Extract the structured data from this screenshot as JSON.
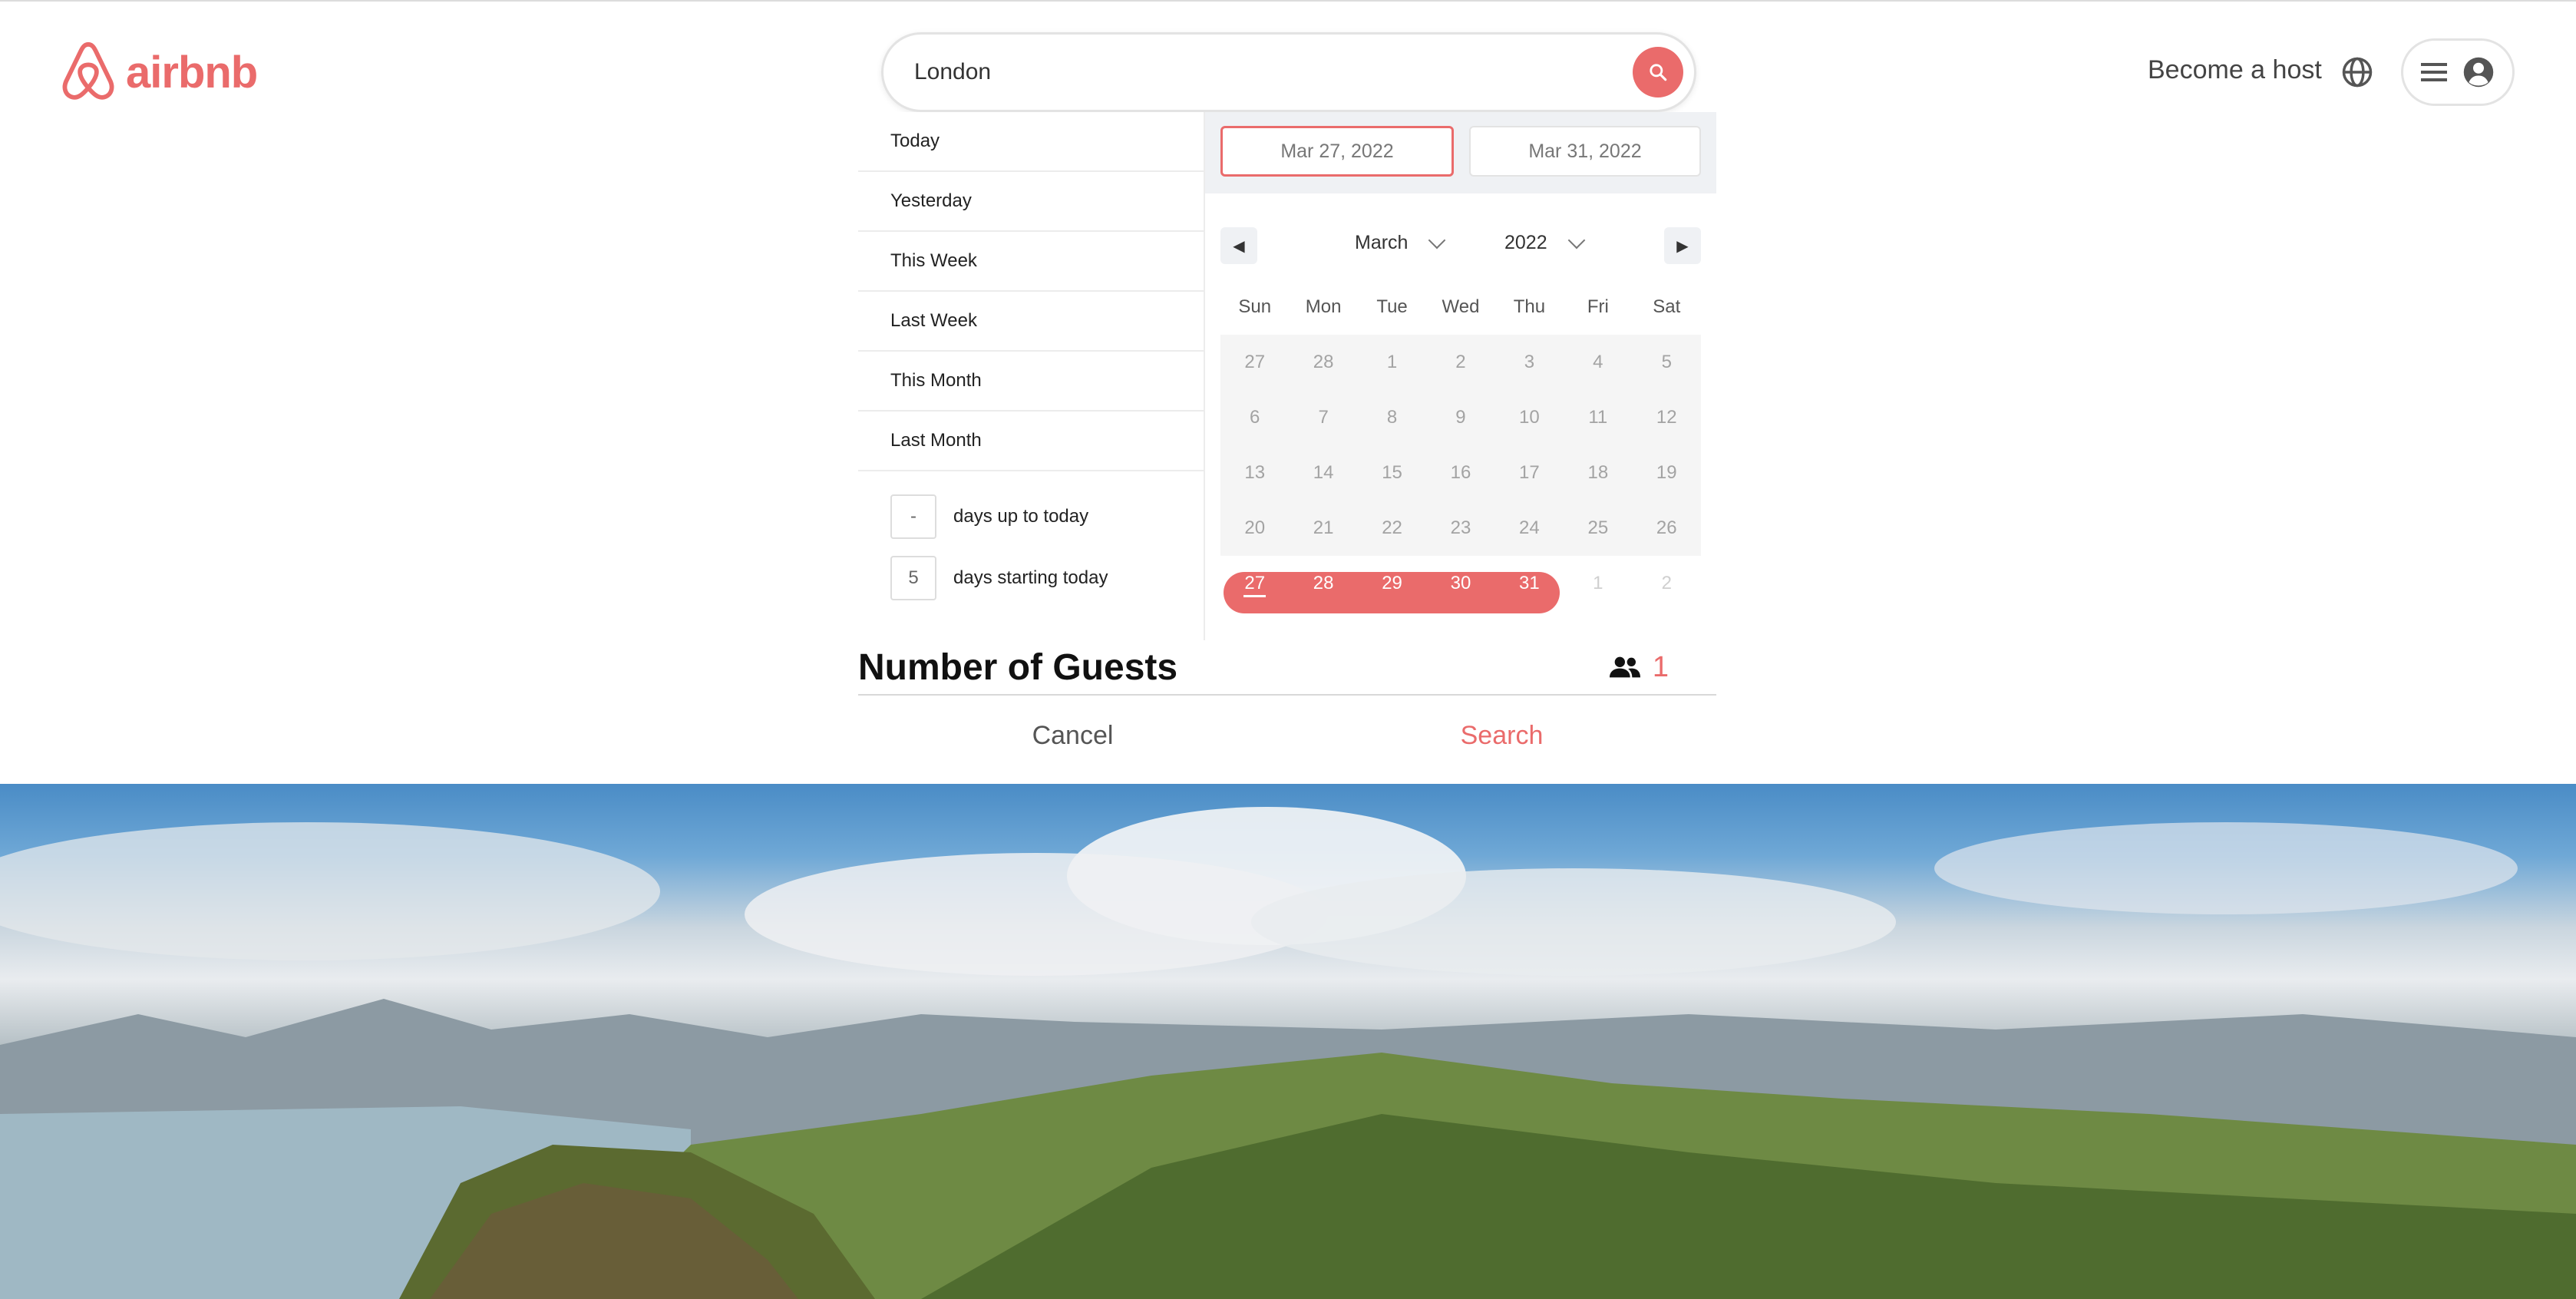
{
  "header": {
    "logo_text": "airbnb",
    "become_host": "Become a host",
    "icons": [
      "airbnb-logo-icon",
      "search-icon",
      "globe-icon",
      "menu-icon",
      "user-icon"
    ]
  },
  "search": {
    "value": "London"
  },
  "date_picker": {
    "presets": [
      "Today",
      "Yesterday",
      "This Week",
      "Last Week",
      "This Month",
      "Last Month"
    ],
    "days_up_to_today": {
      "value": "-",
      "label": "days up to today"
    },
    "days_starting_today": {
      "value": "5",
      "label": "days starting today"
    },
    "start_date": "Mar 27, 2022",
    "end_date": "Mar 31, 2022",
    "month": "March",
    "year": "2022",
    "weekdays": [
      "Sun",
      "Mon",
      "Tue",
      "Wed",
      "Thu",
      "Fri",
      "Sat"
    ],
    "weeks": [
      [
        "27",
        "28",
        "1",
        "2",
        "3",
        "4",
        "5"
      ],
      [
        "6",
        "7",
        "8",
        "9",
        "10",
        "11",
        "12"
      ],
      [
        "13",
        "14",
        "15",
        "16",
        "17",
        "18",
        "19"
      ],
      [
        "20",
        "21",
        "22",
        "23",
        "24",
        "25",
        "26"
      ],
      [
        "27",
        "28",
        "29",
        "30",
        "31",
        "1",
        "2"
      ]
    ]
  },
  "guests": {
    "title": "Number of Guests",
    "count": "1"
  },
  "actions": {
    "cancel": "Cancel",
    "search": "Search"
  },
  "colors": {
    "brand": "#ea6b6b",
    "panel_bg": "#eff1f4"
  }
}
